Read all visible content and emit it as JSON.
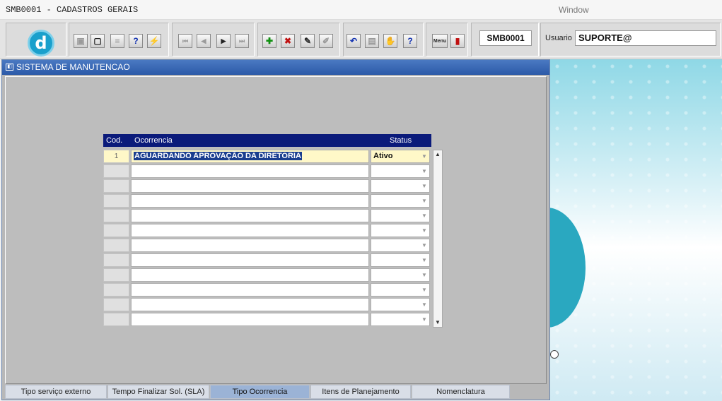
{
  "titlebar": {
    "title": "SMB0001 - CADASTROS GERAIS",
    "window_menu": "Window"
  },
  "toolbar": {
    "logo_letter": "d",
    "form_code": "SMB0001",
    "user_label": "Usuario",
    "user_value": "SUPORTE@",
    "meter_label": "Menu",
    "buttons": [
      {
        "name": "save",
        "glyph": "▣"
      },
      {
        "name": "print-preview",
        "glyph": "▢"
      },
      {
        "name": "print",
        "glyph": "≡"
      },
      {
        "name": "query",
        "glyph": "?"
      },
      {
        "name": "execute-query",
        "glyph": "⚡"
      },
      {
        "name": "first-record",
        "glyph": "⏮"
      },
      {
        "name": "previous-record",
        "glyph": "◀"
      },
      {
        "name": "next-record",
        "glyph": "▶"
      },
      {
        "name": "last-record",
        "glyph": "⏭"
      },
      {
        "name": "insert-record",
        "glyph": "✚"
      },
      {
        "name": "delete-record",
        "glyph": "✖"
      },
      {
        "name": "duplicate-record",
        "glyph": "✎"
      },
      {
        "name": "clear-record",
        "glyph": "✐"
      },
      {
        "name": "undo",
        "glyph": "↶"
      },
      {
        "name": "clipboard",
        "glyph": "▤"
      },
      {
        "name": "attach",
        "glyph": "✋"
      },
      {
        "name": "help",
        "glyph": "?"
      },
      {
        "name": "exit",
        "glyph": "▮"
      }
    ]
  },
  "window": {
    "title": "SISTEMA DE MANUTENCAO"
  },
  "grid": {
    "headers": {
      "cod": "Cod.",
      "ocorrencia": "Ocorrencia",
      "status": "Status"
    },
    "rows": [
      {
        "cod": "1",
        "ocorrencia": "AGUARDANDO APROVAÇÃO DA DIRETORIA",
        "status": "Ativo"
      },
      {
        "cod": "",
        "ocorrencia": "",
        "status": ""
      },
      {
        "cod": "",
        "ocorrencia": "",
        "status": ""
      },
      {
        "cod": "",
        "ocorrencia": "",
        "status": ""
      },
      {
        "cod": "",
        "ocorrencia": "",
        "status": ""
      },
      {
        "cod": "",
        "ocorrencia": "",
        "status": ""
      },
      {
        "cod": "",
        "ocorrencia": "",
        "status": ""
      },
      {
        "cod": "",
        "ocorrencia": "",
        "status": ""
      },
      {
        "cod": "",
        "ocorrencia": "",
        "status": ""
      },
      {
        "cod": "",
        "ocorrencia": "",
        "status": ""
      },
      {
        "cod": "",
        "ocorrencia": "",
        "status": ""
      },
      {
        "cod": "",
        "ocorrencia": "",
        "status": ""
      }
    ]
  },
  "tabs": [
    {
      "label": "Tipo serviço externo",
      "active": false
    },
    {
      "label": "Tempo Finalizar Sol. (SLA)",
      "active": false
    },
    {
      "label": "Tipo Ocorrencia",
      "active": true
    },
    {
      "label": "Itens de Planejamento",
      "active": false
    },
    {
      "label": "Nomenclatura",
      "active": false
    }
  ]
}
